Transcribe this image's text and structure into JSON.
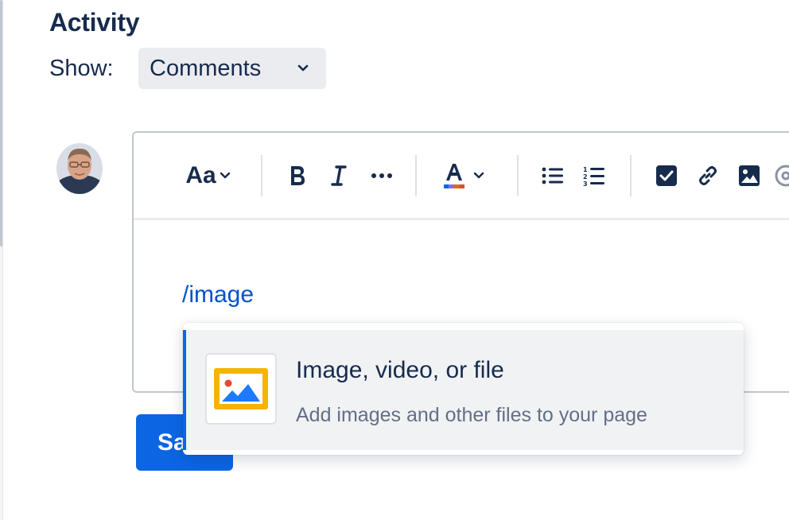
{
  "activity": {
    "title": "Activity",
    "show_label": "Show:",
    "show_select_value": "Comments"
  },
  "editor": {
    "toolbar": {
      "text_style_label": "Aa",
      "buttons": [
        "text-style",
        "bold",
        "italic",
        "more-formatting",
        "text-color",
        "bullet-list",
        "numbered-list",
        "action-item",
        "link",
        "image",
        "mention"
      ]
    },
    "content_text": "/image"
  },
  "typeahead": {
    "items": [
      {
        "title": "Image, video, or file",
        "description": "Add images and other files to your page",
        "icon": "image-icon"
      }
    ]
  },
  "actions": {
    "save_label": "Save"
  },
  "colors": {
    "primary": "#0c66e4",
    "link": "#0052cc",
    "text": "#172b4d",
    "subtle_text": "#626f86",
    "select_bg": "#ebecf0",
    "highlight_bg": "#f1f2f4",
    "icon_yellow": "#f5b400"
  }
}
